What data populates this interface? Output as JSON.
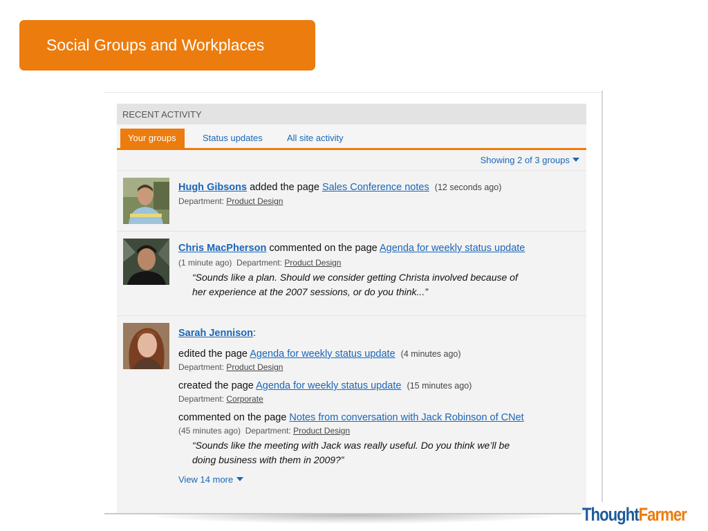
{
  "slide": {
    "title": "Social Groups and Workplaces"
  },
  "widget": {
    "header": "RECENT ACTIVITY",
    "tabs": [
      {
        "label": "Your groups",
        "active": true
      },
      {
        "label": "Status updates",
        "active": false
      },
      {
        "label": "All site activity",
        "active": false
      }
    ],
    "showing": "Showing 2 of 3 groups",
    "entries": [
      {
        "user": "Hugh Gibsons",
        "action": " added the page ",
        "page": "Sales Conference notes",
        "time": "(12 seconds ago)",
        "dept_label": "Department: ",
        "dept": "Product Design"
      },
      {
        "user": "Chris MacPherson",
        "action": " commented on the page ",
        "page": "Agenda for weekly status update",
        "time": "(1 minute ago)",
        "dept_label": "Department: ",
        "dept": "Product Design",
        "quote_line1": "“Sounds like a plan. Should we consider getting Christa involved because of",
        "quote_line2": "her experience at the 2007 sessions, or do you think...”"
      },
      {
        "user": "Sarah Jennison",
        "suffix": ":",
        "items": [
          {
            "action": "edited the page ",
            "page": "Agenda for weekly status update",
            "time": "(4 minutes ago)",
            "dept_label": "Department: ",
            "dept": "Product Design"
          },
          {
            "action": "created the page ",
            "page": "Agenda for weekly status update",
            "time": "(15 minutes ago)",
            "dept_label": "Department: ",
            "dept": "Corporate"
          },
          {
            "action": "commented on the page ",
            "page": "Notes from conversation with Jack Robinson of CNet",
            "time": "(45 minutes ago)",
            "dept_label": "Department: ",
            "dept": "Product Design",
            "quote_line1": "“Sounds like the meeting with Jack was really useful. Do you think we’ll be",
            "quote_line2": "doing business with them in 2009?”"
          }
        ]
      }
    ],
    "view_more": "View 14 more"
  },
  "logo": {
    "part1": "Thought",
    "part2": "Farmer"
  },
  "colors": {
    "accent": "#ec7c0e",
    "link": "#1a66b8",
    "brand_blue": "#1d5b98"
  }
}
